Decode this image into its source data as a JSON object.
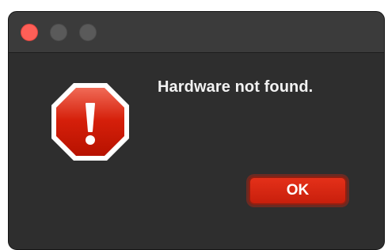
{
  "window": {
    "controls": {
      "close_color": "#ff5f57",
      "minimize_color": "#5a5a5a",
      "zoom_color": "#5a5a5a"
    }
  },
  "dialog": {
    "icon": "stop-alert-icon",
    "icon_color": "#d51f0a",
    "message": "Hardware not found.",
    "ok_label": "OK",
    "button_color": "#d8260f"
  }
}
